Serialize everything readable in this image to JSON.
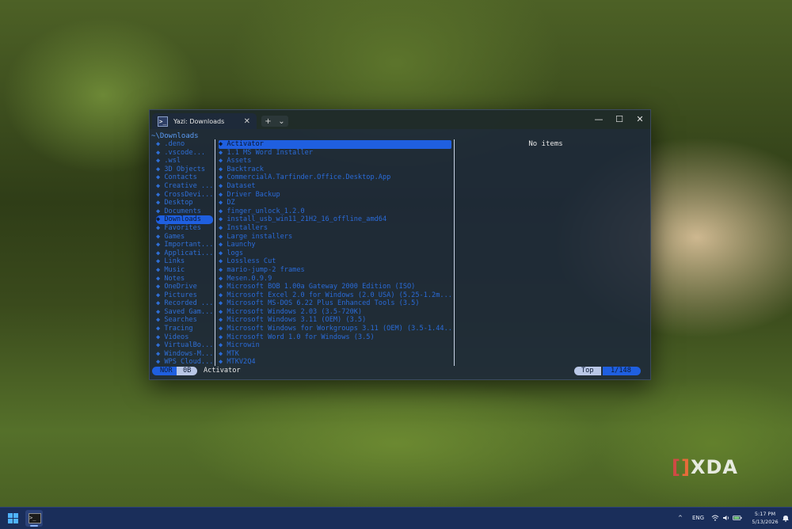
{
  "window": {
    "tab_title": "Yazi: Downloads",
    "tab_icon_glyph": ">_",
    "tab_close": "✕",
    "new_tab": "+",
    "tab_dropdown": "⌄",
    "minimize": "—",
    "maximize": "☐",
    "close": "✕"
  },
  "cwd": "~\\Downloads",
  "parent_items": [
    ".deno",
    ".vscode...",
    ".wsl",
    "3D Objects",
    "Contacts",
    "Creative ...",
    "CrossDevi...",
    "Desktop",
    "Documents",
    "Downloads",
    "Favorites",
    "Games",
    "Important...",
    "Applicati...",
    "Links",
    "Music",
    "Notes",
    "OneDrive",
    "Pictures",
    "Recorded ...",
    "Saved Gam...",
    "Searches",
    "Tracing",
    "Videos",
    "VirtualBo...",
    "Windows-M...",
    "WPS Cloud..."
  ],
  "parent_active_index": 9,
  "current_items": [
    "Activator",
    "1.1 MS Word Installer",
    "Assets",
    "Backtrack",
    "CommercialA.Tarfinder.Office.Desktop.App",
    "Dataset",
    "Driver Backup",
    "DZ",
    "finger_unlock_1.2.0",
    "install_usb_win11_21H2_16_offline_amd64",
    "Installers",
    "Large installers",
    "Launchy",
    "logs",
    "Lossless Cut",
    "mario-jump-2 frames",
    "Mesen.0.9.9",
    "Microsoft BOB 1.00a Gateway 2000 Edition (ISO)",
    "Microsoft Excel 2.0 for Windows (2.0 USA) (5.25-1.2m...",
    "Microsoft MS-DOS 6.22 Plus Enhanced Tools (3.5)",
    "Microsoft Windows 2.03 (3.5-720K)",
    "Microsoft Windows 3.11 (OEM) (3.5)",
    "Microsoft Windows for Workgroups 3.11 (OEM) (3.5-1.44...",
    "Microsoft Word 1.0 for Windows (3.5)",
    "Microwin",
    "MTK",
    "MTKV2Q4"
  ],
  "current_active_index": 0,
  "preview_text": "No items",
  "status": {
    "mode": "NOR",
    "size": "0B",
    "file": "Activator",
    "position_label": "Top",
    "position_count": "1/148"
  },
  "watermark": "XDA",
  "taskbar": {
    "language": "ENG",
    "time": "5:17 PM",
    "date": "5/13/2026",
    "chevron": "^",
    "icons": [
      "start-icon",
      "terminal-icon",
      "wifi-icon",
      "volume-icon",
      "battery-icon",
      "notification-icon"
    ]
  },
  "colors": {
    "accent": "#1f5fe0",
    "item_text": "#2a6bd8",
    "cwd": "#5b9cf5",
    "window_bg": "#1c283a"
  }
}
